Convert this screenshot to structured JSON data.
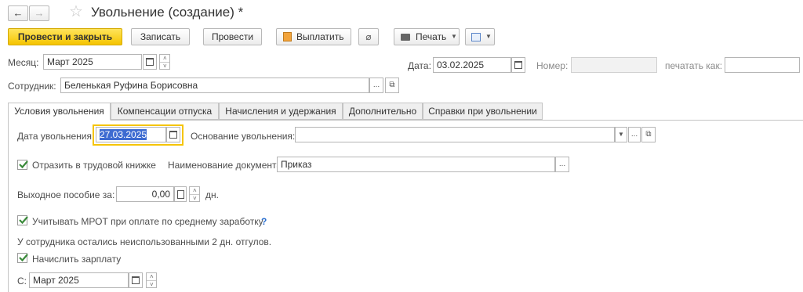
{
  "window": {
    "title": "Увольнение (создание) *"
  },
  "toolbar": {
    "post_and_close": "Провести и закрыть",
    "save": "Записать",
    "post": "Провести",
    "pay": "Выплатить",
    "print": "Печать"
  },
  "header": {
    "month_label": "Месяц:",
    "month_value": "Март 2025",
    "date_label": "Дата:",
    "date_value": "03.02.2025",
    "number_label": "Номер:",
    "number_value": "",
    "print_as_label": "печатать как:",
    "print_as_value": "",
    "employee_label": "Сотрудник:",
    "employee_value": "Беленькая Руфина Борисовна"
  },
  "tabs": [
    {
      "label": "Условия увольнения",
      "active": true
    },
    {
      "label": "Компенсации отпуска",
      "active": false
    },
    {
      "label": "Начисления и удержания",
      "active": false
    },
    {
      "label": "Дополнительно",
      "active": false
    },
    {
      "label": "Справки при увольнении",
      "active": false
    }
  ],
  "conditions": {
    "dismissal_date_label": "Дата увольнения:",
    "dismissal_date_value": "27.03.2025",
    "basis_label": "Основание увольнения:",
    "basis_value": "",
    "workbook_checkbox_label": "Отразить в трудовой книжке",
    "workbook_checked": true,
    "doc_name_label": "Наименование документа:",
    "doc_name_value": "Приказ",
    "severance_label": "Выходное пособие за:",
    "severance_value": "0,00",
    "severance_unit": "дн.",
    "mrot_checkbox_label": "Учитывать МРОТ при оплате по среднему заработку",
    "mrot_checked": true,
    "mrot_help": "?",
    "unused_vacation_text": "У сотрудника остались неиспользованными 2 дн. отгулов.",
    "accrue_salary_label": "Начислить зарплату",
    "accrue_salary_checked": true,
    "from_label": "С:",
    "from_value": "Март 2025"
  },
  "colors": {
    "primary_button": "#f5c400",
    "focus_border": "#f5c400",
    "checkmark": "#3a8a3a",
    "help": "#2a6fcf"
  }
}
